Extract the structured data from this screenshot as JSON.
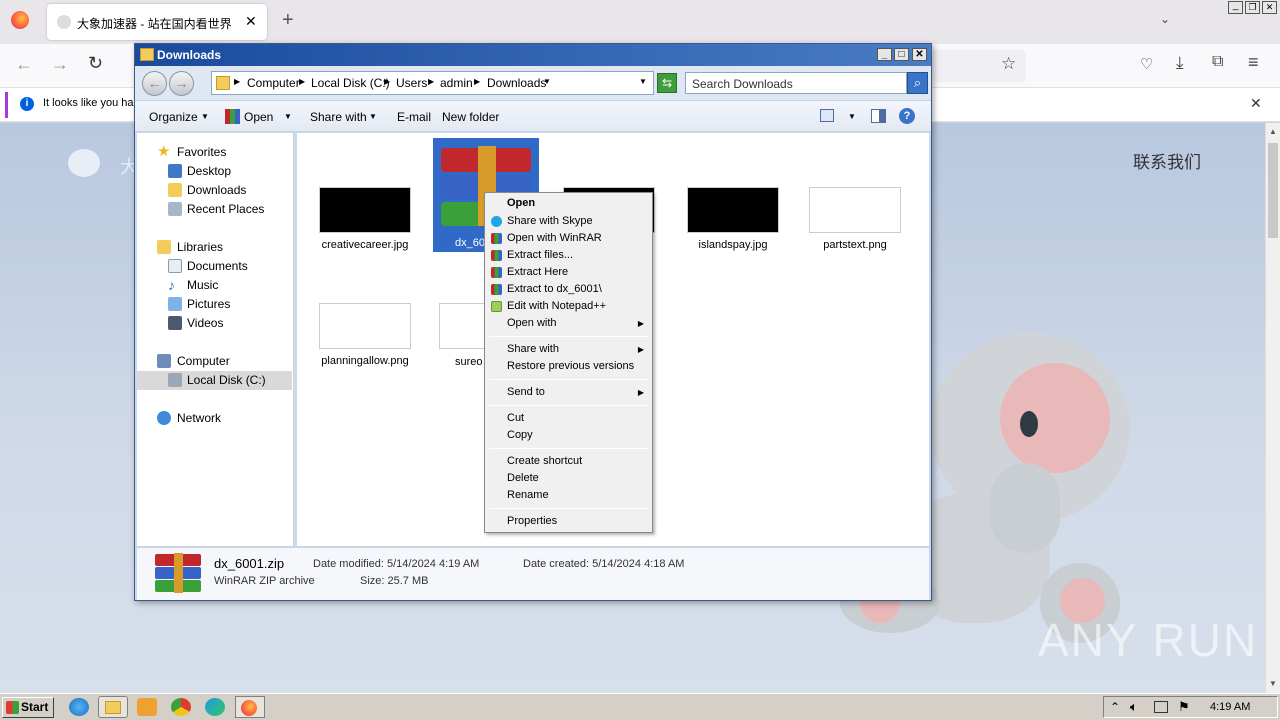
{
  "browser": {
    "tab_title": "大象加速器 - 站在国内看世界",
    "new_tab": "+",
    "notice_text": "It looks like you ha",
    "page_link": "联系我们",
    "page_logo_char": "大",
    "window_controls": [
      "_",
      "❐",
      "✕"
    ]
  },
  "explorer": {
    "title": "Downloads",
    "breadcrumb": [
      "Computer",
      "Local Disk (C:)",
      "Users",
      "admin",
      "Downloads"
    ],
    "search_placeholder": "Search Downloads",
    "toolbar": {
      "organize": "Organize",
      "open": "Open",
      "share_with": "Share with",
      "email": "E-mail",
      "new_folder": "New folder"
    },
    "nav": {
      "favorites": "Favorites",
      "desktop": "Desktop",
      "downloads": "Downloads",
      "recent_places": "Recent Places",
      "libraries": "Libraries",
      "documents": "Documents",
      "music": "Music",
      "pictures": "Pictures",
      "videos": "Videos",
      "computer": "Computer",
      "local_disk": "Local Disk (C:)",
      "network": "Network"
    },
    "files": [
      {
        "name": "creativecareer.jpg"
      },
      {
        "name": "dx_60"
      },
      {
        "name": "g"
      },
      {
        "name": "islandspay.jpg"
      },
      {
        "name": "partstext.png"
      },
      {
        "name": "planningallow.png"
      },
      {
        "name": "sureo"
      }
    ],
    "details": {
      "name": "dx_6001.zip",
      "type": "WinRAR ZIP archive",
      "modified": "Date modified: 5/14/2024 4:19 AM",
      "size": "Size: 25.7 MB",
      "created": "Date created: 5/14/2024 4:18 AM"
    }
  },
  "context_menu": {
    "open": "Open",
    "share_skype": "Share with Skype",
    "open_winrar": "Open with WinRAR",
    "extract_files": "Extract files...",
    "extract_here": "Extract Here",
    "extract_to": "Extract to dx_6001\\",
    "edit_npp": "Edit with Notepad++",
    "open_with": "Open with",
    "share_with": "Share with",
    "restore": "Restore previous versions",
    "send_to": "Send to",
    "cut": "Cut",
    "copy": "Copy",
    "create_shortcut": "Create shortcut",
    "delete": "Delete",
    "rename": "Rename",
    "properties": "Properties"
  },
  "taskbar": {
    "start": "Start",
    "clock": "4:19 AM"
  },
  "watermark": "ANY RUN",
  "colors": {
    "title_blue": "#1a4a9c",
    "selection": "#3169c6",
    "winrar_red": "#c0282d"
  }
}
